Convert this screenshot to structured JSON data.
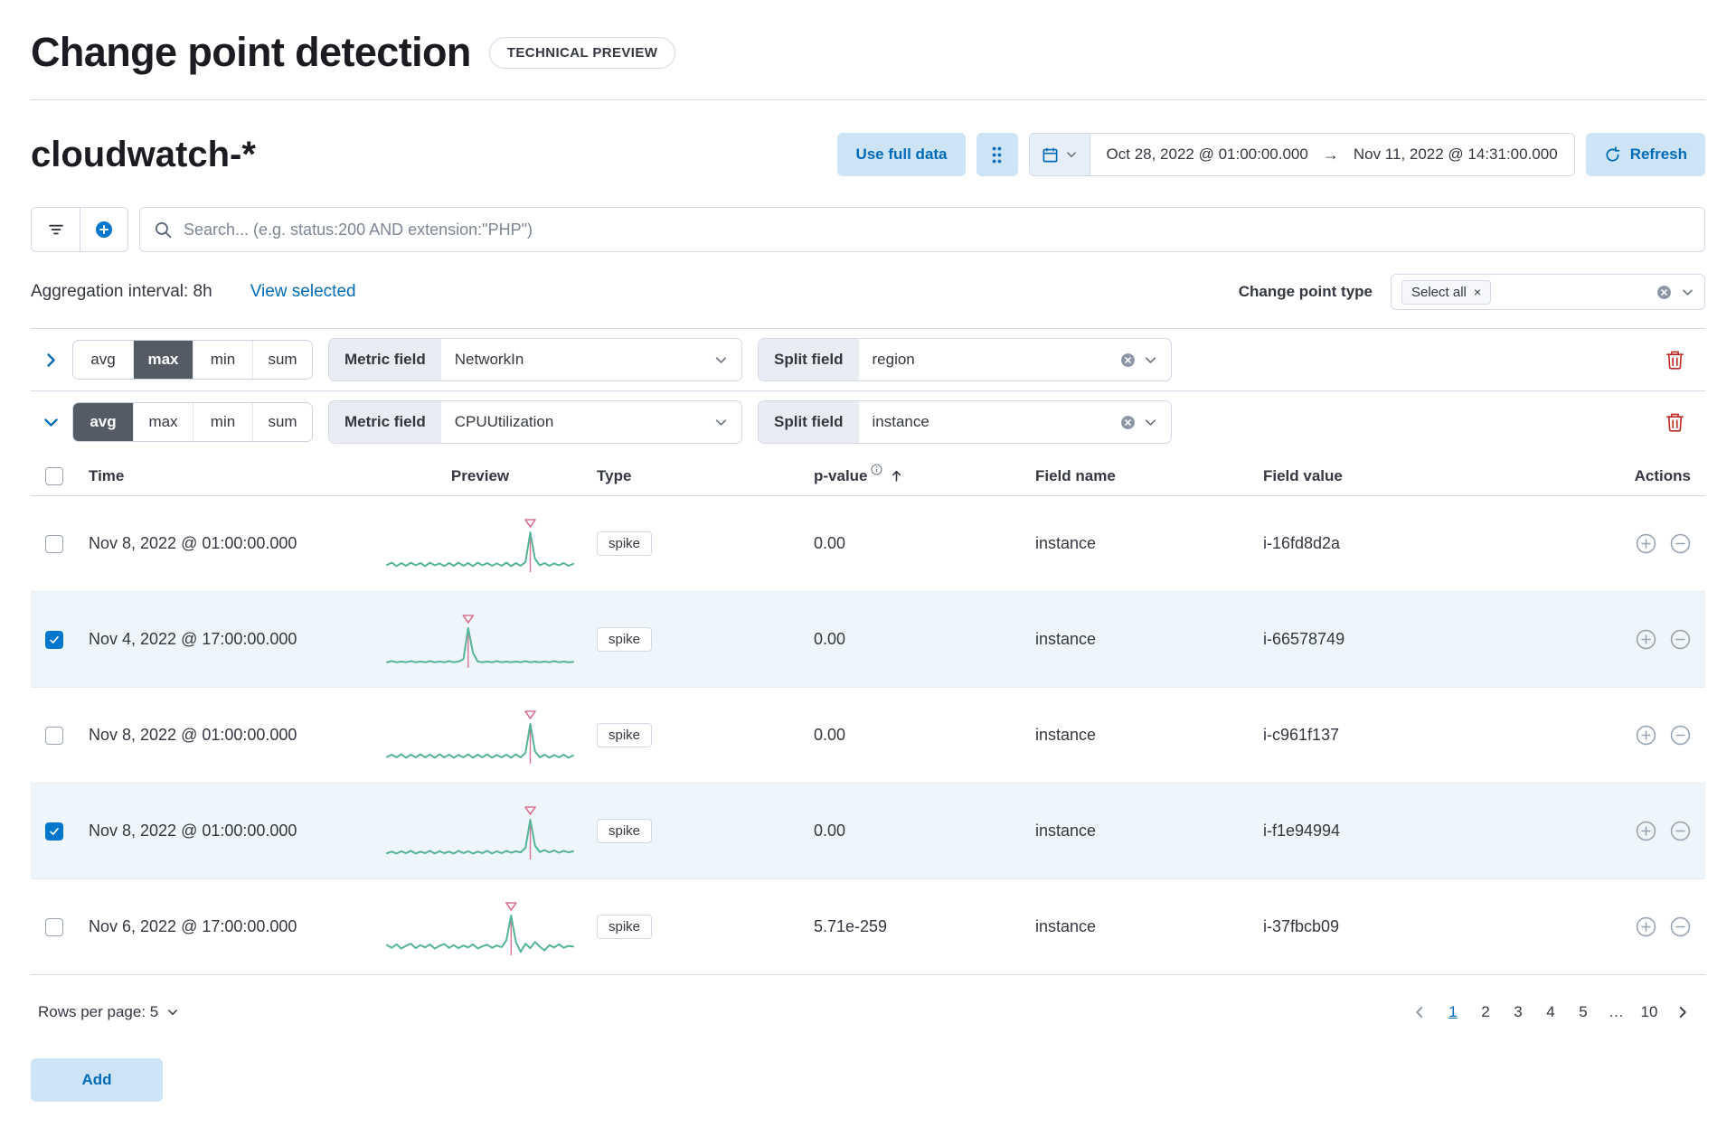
{
  "page": {
    "title": "Change point detection",
    "badge": "TECHNICAL PREVIEW",
    "index_pattern": "cloudwatch-*"
  },
  "toolbar": {
    "use_full_data_label": "Use full data",
    "date_start": "Oct 28, 2022 @ 01:00:00.000",
    "date_end": "Nov 11, 2022 @ 14:31:00.000",
    "refresh_label": "Refresh"
  },
  "search": {
    "placeholder": "Search... (e.g. status:200 AND extension:\"PHP\")"
  },
  "filter_bar": {
    "aggregation_interval": "Aggregation interval: 8h",
    "view_selected": "View selected",
    "change_point_type_label": "Change point type",
    "selected_type_tag": "Select all"
  },
  "configs": [
    {
      "expanded": false,
      "fn_options": [
        "avg",
        "max",
        "min",
        "sum"
      ],
      "selected_fn": "max",
      "metric_label": "Metric field",
      "metric_value": "NetworkIn",
      "split_label": "Split field",
      "split_value": "region"
    },
    {
      "expanded": true,
      "fn_options": [
        "avg",
        "max",
        "min",
        "sum"
      ],
      "selected_fn": "avg",
      "metric_label": "Metric field",
      "metric_value": "CPUUtilization",
      "split_label": "Split field",
      "split_value": "instance"
    }
  ],
  "table": {
    "columns": {
      "time": "Time",
      "preview": "Preview",
      "type": "Type",
      "p_value": "p-value",
      "field_name": "Field name",
      "field_value": "Field value",
      "actions": "Actions"
    },
    "rows": [
      {
        "checked": false,
        "time": "Nov 8, 2022 @ 01:00:00.000",
        "type": "spike",
        "p_value": "0.00",
        "field_name": "instance",
        "field_value": "i-16fd8d2a",
        "spike_index": 30,
        "spark": [
          0.14,
          0.2,
          0.11,
          0.19,
          0.12,
          0.2,
          0.13,
          0.19,
          0.11,
          0.2,
          0.13,
          0.18,
          0.11,
          0.19,
          0.12,
          0.2,
          0.12,
          0.19,
          0.11,
          0.2,
          0.13,
          0.19,
          0.12,
          0.18,
          0.12,
          0.2,
          0.11,
          0.19,
          0.12,
          0.22,
          1.0,
          0.3,
          0.13,
          0.19,
          0.12,
          0.18,
          0.13,
          0.19,
          0.12,
          0.17
        ]
      },
      {
        "checked": true,
        "time": "Nov 4, 2022 @ 17:00:00.000",
        "type": "spike",
        "p_value": "0.00",
        "field_name": "instance",
        "field_value": "i-66578749",
        "spike_index": 17,
        "spark": [
          0.1,
          0.13,
          0.1,
          0.12,
          0.1,
          0.13,
          0.1,
          0.12,
          0.1,
          0.13,
          0.1,
          0.12,
          0.1,
          0.13,
          0.1,
          0.12,
          0.18,
          1.0,
          0.35,
          0.12,
          0.1,
          0.12,
          0.1,
          0.13,
          0.1,
          0.12,
          0.1,
          0.12,
          0.1,
          0.13,
          0.1,
          0.12,
          0.1,
          0.12,
          0.1,
          0.13,
          0.1,
          0.12,
          0.1,
          0.11
        ]
      },
      {
        "checked": false,
        "time": "Nov 8, 2022 @ 01:00:00.000",
        "type": "spike",
        "p_value": "0.00",
        "field_name": "instance",
        "field_value": "i-c961f137",
        "spike_index": 30,
        "spark": [
          0.13,
          0.19,
          0.12,
          0.2,
          0.11,
          0.19,
          0.12,
          0.2,
          0.12,
          0.19,
          0.11,
          0.2,
          0.12,
          0.19,
          0.11,
          0.18,
          0.12,
          0.2,
          0.11,
          0.19,
          0.12,
          0.2,
          0.11,
          0.18,
          0.12,
          0.19,
          0.11,
          0.2,
          0.12,
          0.24,
          1.0,
          0.28,
          0.12,
          0.19,
          0.11,
          0.18,
          0.12,
          0.19,
          0.11,
          0.17
        ]
      },
      {
        "checked": true,
        "time": "Nov 8, 2022 @ 01:00:00.000",
        "type": "spike",
        "p_value": "0.00",
        "field_name": "instance",
        "field_value": "i-f1e94994",
        "spike_index": 30,
        "spark": [
          0.12,
          0.16,
          0.11,
          0.17,
          0.12,
          0.18,
          0.11,
          0.16,
          0.12,
          0.18,
          0.11,
          0.17,
          0.12,
          0.16,
          0.11,
          0.18,
          0.12,
          0.17,
          0.11,
          0.16,
          0.12,
          0.18,
          0.11,
          0.17,
          0.12,
          0.18,
          0.13,
          0.17,
          0.14,
          0.26,
          1.0,
          0.32,
          0.15,
          0.2,
          0.14,
          0.19,
          0.13,
          0.18,
          0.14,
          0.17
        ]
      },
      {
        "checked": false,
        "time": "Nov 6, 2022 @ 17:00:00.000",
        "type": "spike",
        "p_value": "5.71e-259",
        "field_name": "instance",
        "field_value": "i-37fbcb09",
        "spike_index": 26,
        "spark": [
          0.22,
          0.15,
          0.24,
          0.13,
          0.2,
          0.26,
          0.14,
          0.22,
          0.16,
          0.24,
          0.13,
          0.2,
          0.25,
          0.15,
          0.22,
          0.14,
          0.21,
          0.16,
          0.24,
          0.13,
          0.19,
          0.23,
          0.15,
          0.21,
          0.17,
          0.35,
          1.0,
          0.3,
          0.04,
          0.26,
          0.14,
          0.3,
          0.18,
          0.08,
          0.22,
          0.16,
          0.24,
          0.15,
          0.2,
          0.18
        ]
      }
    ]
  },
  "pagination": {
    "rows_per_page_label": "Rows per page: 5",
    "pages": [
      "1",
      "2",
      "3",
      "4",
      "5",
      "…",
      "10"
    ],
    "current_page": "1"
  },
  "add_button_label": "Add",
  "colors": {
    "accent_blue": "#006bb8",
    "spark_green": "#54b399",
    "spark_pink": "#d9738f",
    "danger_red": "#bd271e",
    "selected_row_bg": "#eef5fb"
  }
}
